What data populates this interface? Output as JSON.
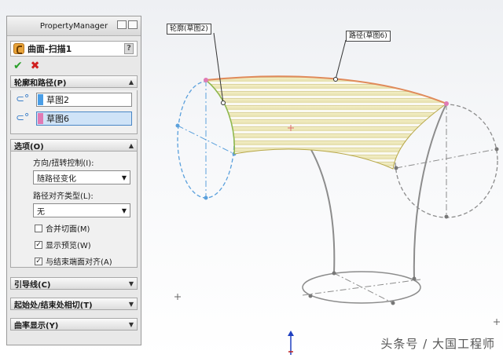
{
  "property_manager": {
    "header_title": "PropertyManager",
    "feature_title": "曲面-扫描1",
    "help_label": "?",
    "ok_icon": "check-icon",
    "cancel_icon": "x-icon",
    "colors": {
      "accent": "#3a7ec8",
      "profile_swatch": "#4a9ee6",
      "path_swatch": "#e07ab4",
      "ok": "#2aa02a",
      "cancel": "#d02020"
    }
  },
  "profile_path_group": {
    "title": "轮廓和路径(P)",
    "profile_value": "草图2",
    "path_value": "草图6"
  },
  "options_group": {
    "title": "选项(O)",
    "orientation_label": "方向/扭转控制(I):",
    "orientation_value": "随路径变化",
    "path_align_label": "路径对齐类型(L):",
    "path_align_value": "无",
    "merge_faces_label": "合并切面(M)",
    "merge_faces_checked": false,
    "show_preview_label": "显示预览(W)",
    "show_preview_checked": true,
    "align_end_label": "与结束端面对齐(A)",
    "align_end_checked": true
  },
  "collapsed_groups": [
    {
      "title": "引导线(C)"
    },
    {
      "title": "起始处/结束处相切(T)"
    },
    {
      "title": "曲率显示(Y)"
    }
  ],
  "viewport": {
    "callout_profile": "轮廓(草图2)",
    "callout_path": "路径(草图6)",
    "watermark": "头条号 / 大国工程师"
  }
}
